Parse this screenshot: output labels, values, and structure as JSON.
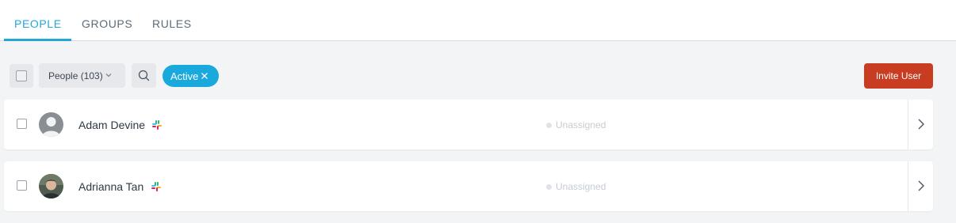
{
  "tabs": [
    {
      "label": "PEOPLE",
      "active": true
    },
    {
      "label": "GROUPS",
      "active": false
    },
    {
      "label": "RULES",
      "active": false
    }
  ],
  "toolbar": {
    "people_filter": "People (103)",
    "active_chip": "Active",
    "invite_label": "Invite User"
  },
  "rows": [
    {
      "name": "Adam Devine",
      "status": "Unassigned",
      "avatar": "default-avatar"
    },
    {
      "name": "Adrianna Tan",
      "status": "Unassigned",
      "avatar": "photo-avatar"
    }
  ],
  "colors": {
    "accent": "#22a7d6",
    "chip": "#1aa9dc",
    "invite": "#c83c22"
  },
  "icons": [
    "search-icon",
    "chevron-down-icon",
    "close-icon",
    "slack-icon",
    "chevron-right-icon"
  ]
}
